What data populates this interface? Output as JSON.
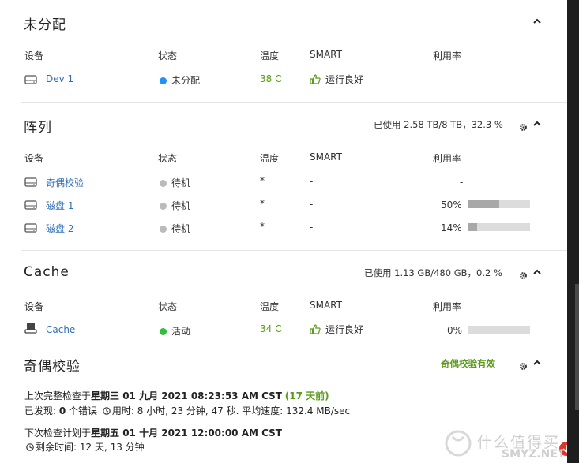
{
  "unassigned": {
    "title": "未分配",
    "headers": {
      "device": "设备",
      "status": "状态",
      "temp": "温度",
      "smart": "SMART",
      "util": "利用率"
    },
    "rows": [
      {
        "name": "Dev 1",
        "status": "未分配",
        "temp": "38 C",
        "smart": "运行良好",
        "util": "-"
      }
    ]
  },
  "array": {
    "title": "阵列",
    "usage": "已使用 2.58 TB/8 TB，32.3 %",
    "headers": {
      "device": "设备",
      "status": "状态",
      "temp": "温度",
      "smart": "SMART",
      "util": "利用率"
    },
    "rows": [
      {
        "name": "奇偶校验",
        "status": "待机",
        "temp": "*",
        "smart": "-",
        "util": "-",
        "util_fraction": null
      },
      {
        "name": "磁盘 1",
        "status": "待机",
        "temp": "*",
        "smart": "-",
        "util": "50%",
        "util_fraction": 0.5
      },
      {
        "name": "磁盘 2",
        "status": "待机",
        "temp": "*",
        "smart": "-",
        "util": "14%",
        "util_fraction": 0.14
      }
    ]
  },
  "cache": {
    "title": "Cache",
    "usage": "已使用 1.13 GB/480 GB，0.2 %",
    "headers": {
      "device": "设备",
      "status": "状态",
      "temp": "温度",
      "smart": "SMART",
      "util": "利用率"
    },
    "rows": [
      {
        "name": "Cache",
        "status": "活动",
        "temp": "34 C",
        "smart": "运行良好",
        "util": "0%",
        "util_fraction": 0.0
      }
    ]
  },
  "parity": {
    "title": "奇偶校验",
    "valid": "奇偶校验有效",
    "last_check_prefix": "上次完整检查于",
    "last_check_date": "星期三 01 九月 2021 08:23:53 AM CST",
    "last_check_ago": "(17 天前)",
    "found_prefix": "已发现: ",
    "found_count": "0",
    "found_suffix": " 个错误",
    "duration_prefix": "用时: ",
    "duration": "8 小时, 23 分钟, 47 秒. 平均速度: 132.4 MB/sec",
    "next_check_prefix": "下次检查计划于",
    "next_check_date": "星期五 01 十月 2021 12:00:00 AM CST",
    "remaining": "剩余时间: 12 天, 13 分钟"
  },
  "watermark": {
    "text": "什么值得买",
    "sub": "SMYZ.NET"
  },
  "colors": {
    "link": "#2f6fb7",
    "green": "#5a9c1a",
    "dot_blue": "#1e90ff",
    "dot_grey": "#bbbbbb",
    "dot_green": "#2fbf3a"
  }
}
